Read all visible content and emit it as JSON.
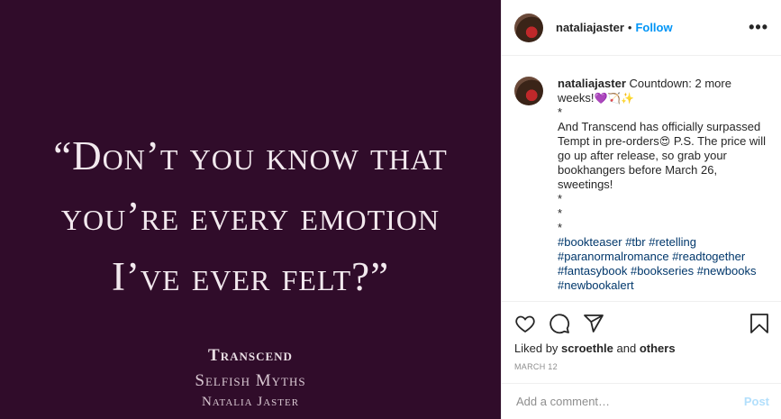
{
  "image": {
    "quote_lines": [
      "“Don’t you know that",
      "you’re every emotion",
      "I’ve ever felt?”"
    ],
    "book_title": "Transcend",
    "book_series": "Selfish Myths",
    "book_author": "Natalia Jaster",
    "background_color": "#300c2a"
  },
  "header": {
    "username": "nataliajaster",
    "separator": "•",
    "follow_label": "Follow",
    "more_icon": "more-horizontal-icon"
  },
  "caption": {
    "username": "nataliajaster",
    "first_line": "Countdown: 2 more weeks!",
    "first_line_emoji": "💜🏹✨",
    "l2": "*",
    "l3": "And Transcend has officially surpassed Tempt in pre-orders",
    "l3_emoji": "😍",
    "l3_rest": " P.S. The price will go up after release, so grab your bookhangers before March 26, sweetings!",
    "l4": "*",
    "l5": "*",
    "l6": "*",
    "hashtags": [
      "#bookteaser",
      "#tbr",
      "#retelling",
      "#paranormalromance",
      "#readtogether",
      "#fantasybook",
      "#bookseries",
      "#newbooks",
      "#newbookalert"
    ]
  },
  "actions": {
    "like_icon": "heart-icon",
    "comment_icon": "comment-icon",
    "share_icon": "share-icon",
    "save_icon": "bookmark-icon",
    "liked_by_prefix": "Liked by",
    "liked_by_user": "scroethle",
    "liked_by_and": "and",
    "liked_by_others": "others",
    "date": "March 12"
  },
  "comment": {
    "placeholder": "Add a comment…",
    "post_label": "Post"
  }
}
